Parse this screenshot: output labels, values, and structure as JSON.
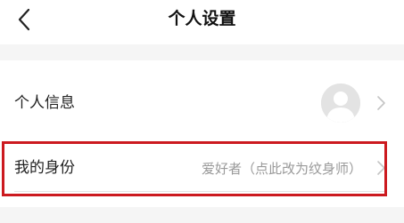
{
  "header": {
    "title": "个人设置",
    "back_icon": "chevron-left-icon"
  },
  "settings": {
    "rows": [
      {
        "label": "个人信息",
        "avatar_icon": "default-avatar-icon",
        "chevron_icon": "chevron-right-icon"
      },
      {
        "label": "我的身份",
        "value": "爱好者（点此改为纹身师）",
        "chevron_icon": "chevron-right-icon"
      }
    ]
  },
  "colors": {
    "highlight_border": "#cc1a1f",
    "background": "#f5f5f5",
    "card": "#ffffff",
    "value_text": "#9a9a9a"
  }
}
